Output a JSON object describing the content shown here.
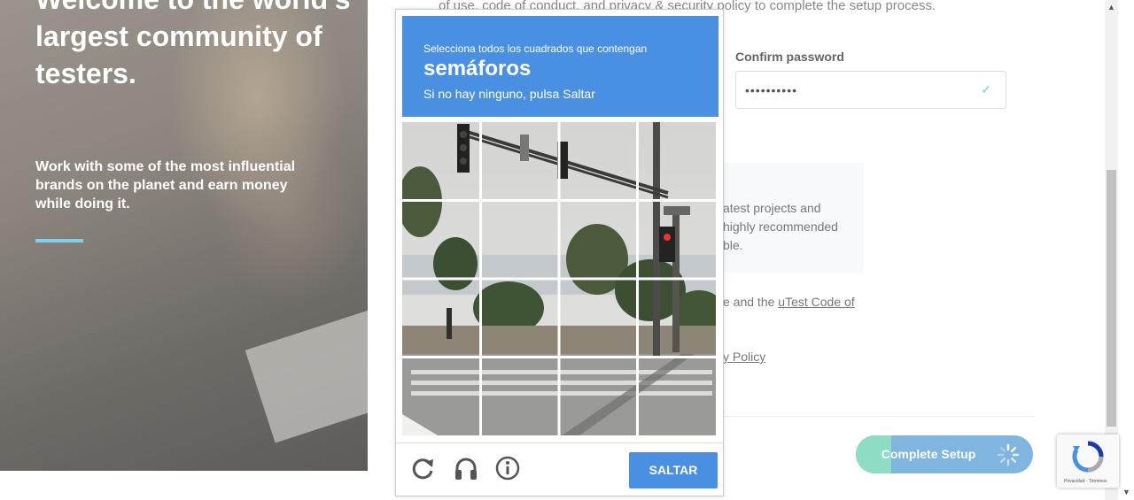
{
  "hero": {
    "title": "Welcome to the world's largest community of testers.",
    "subtitle": "Work with some of the most influential brands on the planet and earn money while doing it."
  },
  "form": {
    "terms_top": "of use, code of conduct, and privacy & security policy to complete the setup process.",
    "confirm_password_label": "Confirm password",
    "confirm_password_value": "••••••••••",
    "info_text": "atest projects and highly recommended ble.",
    "agree_prefix": "e and the ",
    "agree_link": "uTest Code of",
    "privacy_link": "y Policy",
    "complete_button": "Complete Setup"
  },
  "captcha": {
    "instruction": "Selecciona todos los cuadrados que contengan",
    "target": "semáforos",
    "hint": "Si no hay ninguno, pulsa Saltar",
    "skip_button": "SALTAR",
    "grid_size": 4
  },
  "recaptcha_badge": {
    "text": "Privacidad - Términos"
  }
}
